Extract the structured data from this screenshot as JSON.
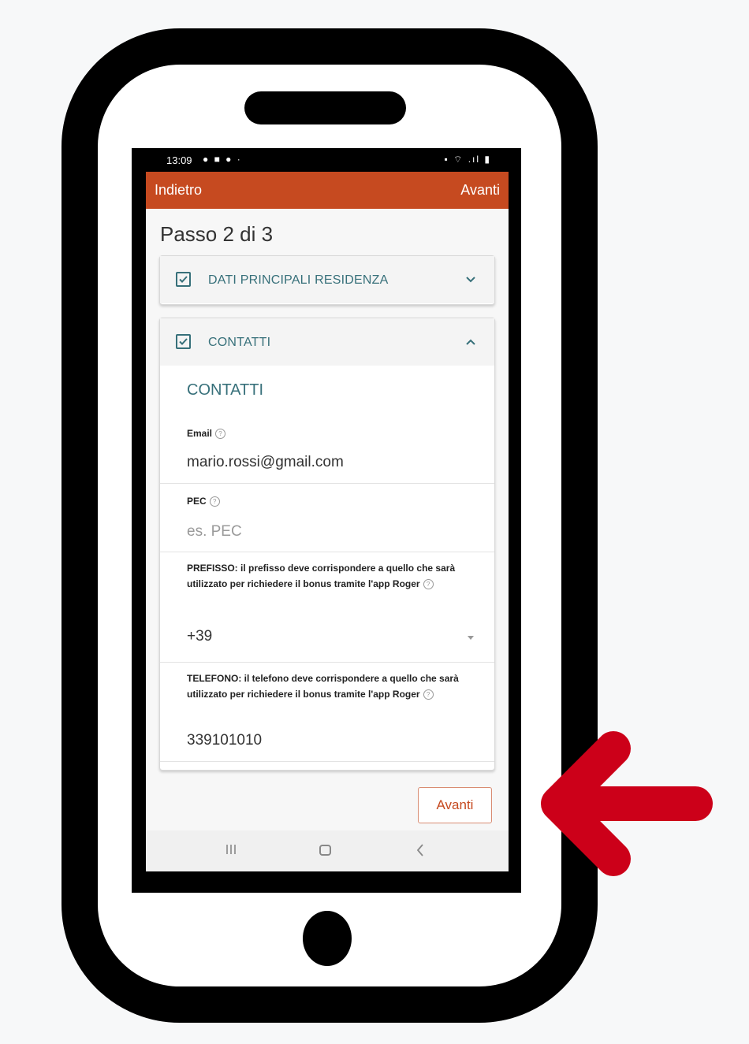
{
  "status_bar": {
    "time": "13:09",
    "left_icons": "● ■ ● ·",
    "right_icons": "▪ ⌔ .ıl ▮"
  },
  "app_bar": {
    "back_label": "Indietro",
    "next_label": "Avanti",
    "color": "#c64a20"
  },
  "step_title": "Passo 2 di 3",
  "sections": [
    {
      "title": "DATI PRINCIPALI RESIDENZA",
      "checked": true,
      "expanded": false
    },
    {
      "title": "CONTATTI",
      "checked": true,
      "expanded": true
    }
  ],
  "contacts": {
    "heading": "CONTATTI",
    "email": {
      "label": "Email",
      "value": "mario.rossi@gmail.com"
    },
    "pec": {
      "label": "PEC",
      "value": "",
      "placeholder": "es. PEC"
    },
    "prefix": {
      "label": "PREFISSO: il prefisso deve corrispondere a quello che sarà utilizzato per richiedere il bonus tramite l'app Roger",
      "value": "+39"
    },
    "phone": {
      "label": "TELEFONO: il telefono deve corrispondere a quello che sarà utilizzato per richiedere il bonus tramite l'app Roger",
      "value": "339101010"
    }
  },
  "next_button_label": "Avanti",
  "accent_color": "#37707a",
  "arrow_color": "#cc0019",
  "help_icon": "?"
}
